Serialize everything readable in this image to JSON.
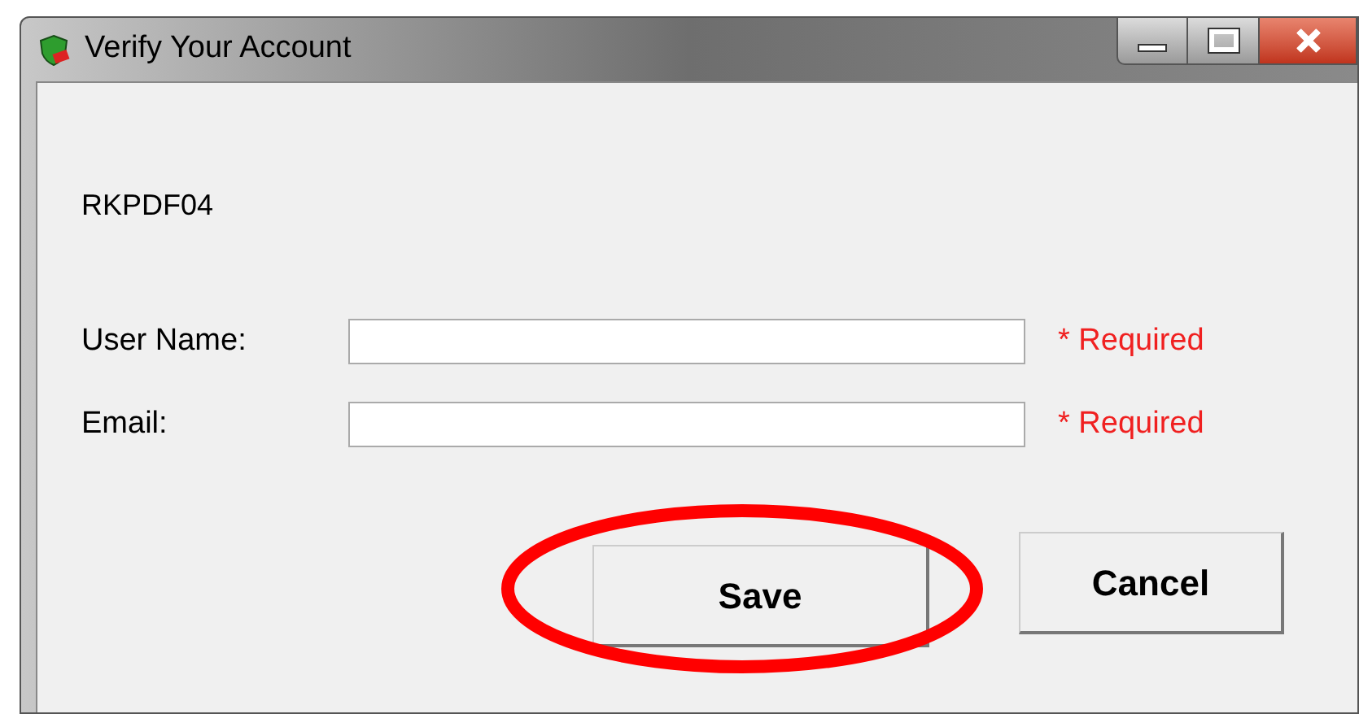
{
  "window": {
    "title": "Verify Your Account"
  },
  "code_label": "RKPDF04",
  "fields": [
    {
      "label": "User Name:",
      "required_note": "* Required"
    },
    {
      "label": "Email:",
      "required_note": "* Required"
    }
  ],
  "buttons": [
    {
      "label": "Save",
      "highlighted": true
    },
    {
      "label": "Cancel",
      "highlighted": false
    }
  ]
}
